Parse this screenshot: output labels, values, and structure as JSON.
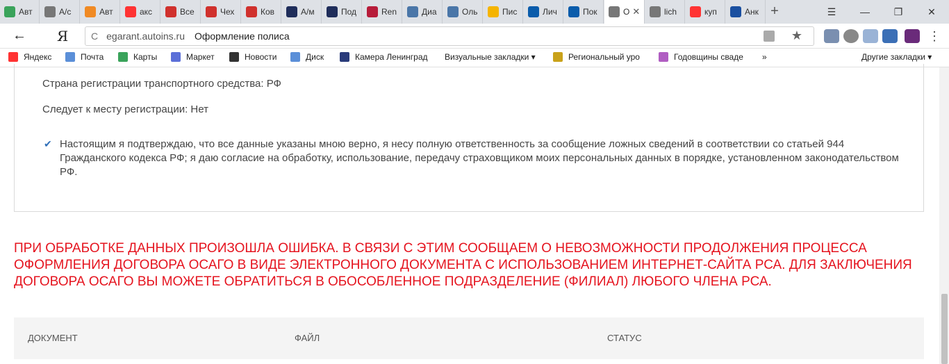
{
  "browser": {
    "tabs": [
      {
        "label": "Авт",
        "icon": "green-globe-icon",
        "color": "#3aa35b"
      },
      {
        "label": "А/с",
        "icon": "page-icon",
        "color": "#777777"
      },
      {
        "label": "Авт",
        "icon": "dns-icon",
        "color": "#f08a24"
      },
      {
        "label": "акс",
        "icon": "yandex-icon",
        "color": "#ff3333"
      },
      {
        "label": "Все",
        "icon": "red-logo-icon",
        "color": "#d0312d"
      },
      {
        "label": "Чех",
        "icon": "red-logo-icon",
        "color": "#d0312d"
      },
      {
        "label": "Ков",
        "icon": "red-logo-icon",
        "color": "#d0312d"
      },
      {
        "label": "А/м",
        "icon": "navy-a-icon",
        "color": "#1f2d5a"
      },
      {
        "label": "Под",
        "icon": "navy-a-icon",
        "color": "#1f2d5a"
      },
      {
        "label": "Ren",
        "icon": "d-icon",
        "color": "#b71c3a"
      },
      {
        "label": "Диа",
        "icon": "chat-icon",
        "color": "#4a76a8"
      },
      {
        "label": "Оль",
        "icon": "vk-icon",
        "color": "#4a76a8"
      },
      {
        "label": "Пис",
        "icon": "mail-icon",
        "color": "#f5b400"
      },
      {
        "label": "Лич",
        "icon": "vsk-icon",
        "color": "#0a5cab"
      },
      {
        "label": "Пок",
        "icon": "vsk-icon",
        "color": "#0a5cab"
      },
      {
        "label": "О",
        "icon": "page-icon",
        "color": "#777777",
        "active": true
      },
      {
        "label": "lich",
        "icon": "loading-icon",
        "color": "#777777"
      },
      {
        "label": "куп",
        "icon": "yandex-icon",
        "color": "#ff3333"
      },
      {
        "label": "Анк",
        "icon": "blue-i-icon",
        "color": "#1a4fa0"
      }
    ],
    "ya_letter": "Я",
    "address_host": "egarant.autoins.ru",
    "page_title": "Оформление полиса",
    "bookmarks": [
      {
        "label": "Яндекс",
        "color": "#ff3333"
      },
      {
        "label": "Почта",
        "color": "#5b8fd8"
      },
      {
        "label": "Карты",
        "color": "#3aa35b"
      },
      {
        "label": "Маркет",
        "color": "#5b6fd8"
      },
      {
        "label": "Новости",
        "color": "#333333"
      },
      {
        "label": "Диск",
        "color": "#5b8fd8"
      },
      {
        "label": "Камера Ленинград",
        "color": "#2a3b7a"
      },
      {
        "label": "Визуальные закладки ▾",
        "color": "#ffffff"
      },
      {
        "label": "Региональный уро",
        "color": "#c9a21a"
      },
      {
        "label": "Годовщины сваде",
        "color": "#b05ec2"
      }
    ],
    "more_bookmarks": "»",
    "other_bookmarks": "Другие закладки ▾"
  },
  "form": {
    "country": "Страна регистрации транспортного средства: РФ",
    "follows": "Следует к месту регистрации: Нет",
    "consent": "Настоящим я подтверждаю, что все данные указаны мною верно, я несу полную ответственность за сообщение ложных сведений в соответствии со статьей 944 Гражданского кодекса РФ; я даю согласие на обработку, использование, передачу страховщиком моих персональных данных в порядке, установленном законодательством РФ.",
    "consent_checked": true
  },
  "error_message": "ПРИ ОБРАБОТКЕ ДАННЫХ ПРОИЗОШЛА ОШИБКА. В СВЯЗИ С ЭТИМ СООБЩАЕМ О НЕВОЗМОЖНОСТИ ПРОДОЛЖЕНИЯ ПРОЦЕССА ОФОРМЛЕНИЯ ДОГОВОРА ОСАГО В ВИДЕ ЭЛЕКТРОННОГО ДОКУМЕНТА С ИСПОЛЬЗОВАНИЕМ ИНТЕРНЕТ-САЙТА РСА. ДЛЯ ЗАКЛЮЧЕНИЯ ДОГОВОРА ОСАГО ВЫ МОЖЕТЕ ОБРАТИТЬСЯ В ОБОСОБЛЕННОЕ ПОДРАЗДЕЛЕНИЕ (ФИЛИАЛ) ЛЮБОГО ЧЛЕНА РСА.",
  "table": {
    "columns": [
      "ДОКУМЕНТ",
      "ФАЙЛ",
      "СТАТУС"
    ]
  },
  "colors": {
    "error": "#e5141f",
    "checkbox": "#2f6fb8"
  }
}
